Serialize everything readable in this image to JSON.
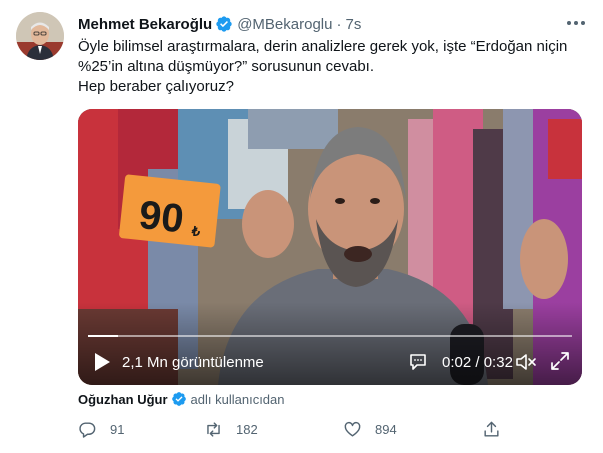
{
  "tweet": {
    "author_name": "Mehmet Bekaroğlu",
    "handle": "@MBekaroglu",
    "separator": "·",
    "time": "7s",
    "text_lines": [
      "Öyle bilimsel araştırmalara, derin analizlere gerek yok, işte “Erdoğan niçin",
      "%25’in altına düşmüyor?” sorusunun cevabı.",
      "Hep beraber çalıyoruz?"
    ]
  },
  "video": {
    "views": "2,1 Mn görüntülenme",
    "current_time": "0:02",
    "separator": "/",
    "duration": "0:32",
    "progress": 0.0625,
    "price_tag": "90",
    "currency_symbol": "₺"
  },
  "attribution": {
    "name": "Oğuzhan Uğur",
    "suffix": "adlı kullanıcıdan"
  },
  "actions": {
    "replies": "91",
    "retweets": "182",
    "likes": "894"
  },
  "colors": {
    "verified": "#1d9bf0",
    "text": "#0f1419",
    "muted": "#536471",
    "price_tag_bg": "#f49a3c"
  }
}
